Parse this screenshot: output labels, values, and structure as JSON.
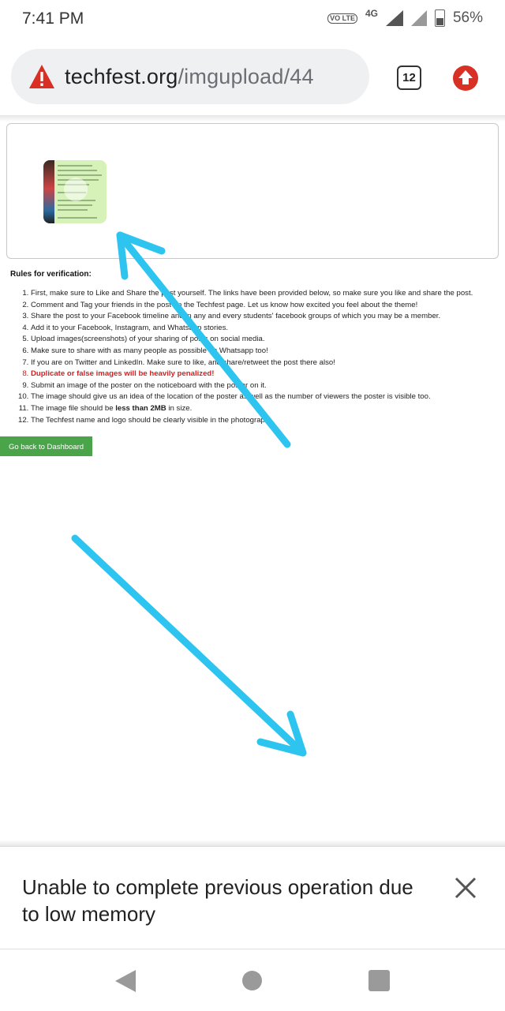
{
  "status_bar": {
    "time": "7:41 PM",
    "volte": "VO LTE",
    "network": "4G",
    "battery": "56%",
    "battery_level": 0.56
  },
  "browser": {
    "url_domain": "techfest.org",
    "url_path": "/imgupload/44",
    "tab_count": "12",
    "icons": [
      "warning-icon",
      "tab-switcher-icon",
      "upload-icon"
    ]
  },
  "page": {
    "rules_title": "Rules for verification:",
    "rules": [
      "First, make sure to Like and Share the post yourself. The links have been provided below, so make sure you like and share the post.",
      "Comment and Tag your friends in the post on the Techfest page. Let us know how excited you feel about the theme!",
      "Share the post to your Facebook timeline and in any and every students' facebook groups of which you may be a member.",
      "Add it to your Facebook, Instagram, and Whatsapp stories.",
      "Upload images(screenshots) of your sharing of posts on social media.",
      "Make sure to share with as many people as possible on Whatsapp too!",
      "If you are on Twitter and LinkedIn. Make sure to like, and share/retweet the post there also!",
      "Duplicate or false images will be heavily penalized!",
      "Submit an image of the poster on the noticeboard with the poster on it.",
      "The image should give us an idea of the location of the poster as well as the number of viewers the poster is visible too.",
      "The image file should be less than 2MB in size.",
      "The Techfest name and logo should be clearly visible in the photograph."
    ],
    "rule11_parts": [
      "The image file should be ",
      "less than 2MB",
      " in size."
    ],
    "dashboard_button": "Go back to Dashboard"
  },
  "snackbar": {
    "message": "Unable to complete previous operation due to low memory",
    "close_icon": "close-icon"
  },
  "nav": {
    "icons": [
      "back-icon",
      "home-icon",
      "recents-icon"
    ]
  },
  "colors": {
    "arrow": "#2ec4f0",
    "warning": "#d93025",
    "button_green": "#4aa54a",
    "penalty_red": "#d32020"
  }
}
